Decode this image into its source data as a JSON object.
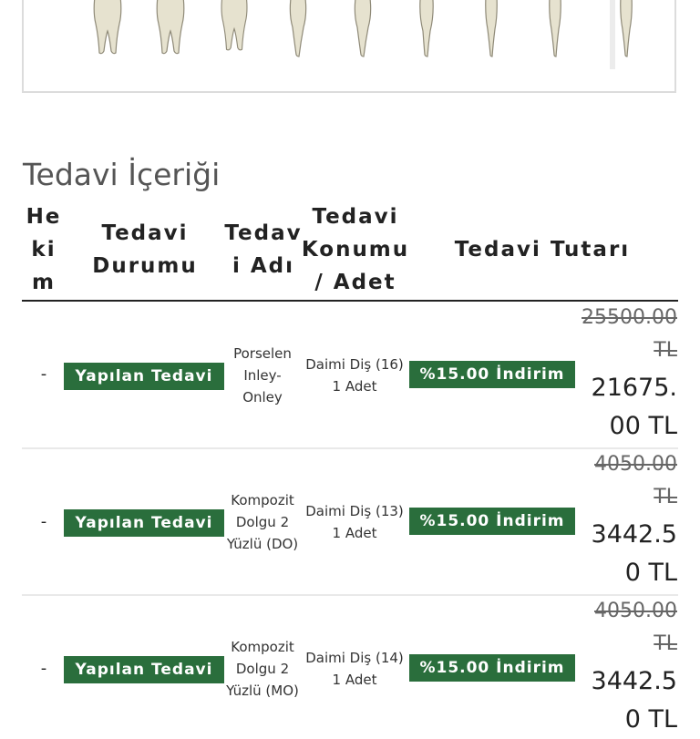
{
  "section": {
    "title": "Tedavi İçeriği"
  },
  "table": {
    "headers": {
      "hekim": "Hekim",
      "durum": "Tedavi Durumu",
      "adi": "Tedavi Adı",
      "konum": "Tedavi Konumu / Adet",
      "tutar": "Tedavi Tutarı"
    },
    "rows": [
      {
        "hekim": "-",
        "status": "Yapılan Tedavi",
        "name": "Porselen Inley-Onley",
        "position": "Daimi Diş (16)",
        "quantity": "1 Adet",
        "discount": "%15.00 İndirim",
        "old_price": "25500.00 TL",
        "new_price": "21675.00 TL"
      },
      {
        "hekim": "-",
        "status": "Yapılan Tedavi",
        "name": "Kompozit Dolgu 2 Yüzlü (DO)",
        "position": "Daimi Diş (13)",
        "quantity": "1 Adet",
        "discount": "%15.00 İndirim",
        "old_price": "4050.00 TL",
        "new_price": "3442.50 TL"
      },
      {
        "hekim": "-",
        "status": "Yapılan Tedavi",
        "name": "Kompozit Dolgu 2 Yüzlü (MO)",
        "position": "Daimi Diş (14)",
        "quantity": "1 Adet",
        "discount": "%15.00 İndirim",
        "old_price": "4050.00 TL",
        "new_price": "3442.50 TL"
      }
    ]
  },
  "icons": {
    "teeth": [
      "molar-tooth-icon",
      "molar-tooth-icon",
      "molar-tooth-icon",
      "premolar-tooth-icon",
      "premolar-tooth-icon",
      "canine-tooth-icon",
      "incisor-tooth-icon",
      "incisor-tooth-icon",
      "incisor-tooth-icon"
    ]
  },
  "colors": {
    "badge": "#2a6e3c",
    "title": "#555555",
    "border": "#dcdcdc"
  }
}
